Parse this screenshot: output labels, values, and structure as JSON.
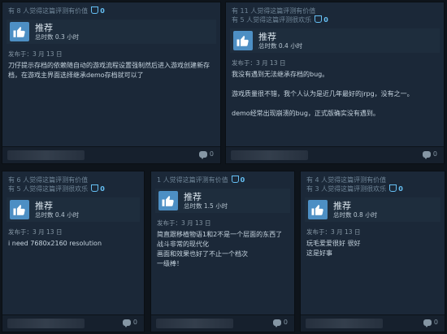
{
  "reviews": [
    {
      "helpful": [
        "有 8 人觉得这篇评测有价值"
      ],
      "award_count": "0",
      "verdict": "推荐",
      "hours": "总时数 0.3 小时",
      "posted": "发布于：3 月 13 日",
      "body": [
        "刀仔提示存档的依赖随自动的游戏流程设置强制然后进入游戏创建新存档，在游戏主界面选择继承demo存档就可以了"
      ],
      "comments": "0"
    },
    {
      "helpful": [
        "有 11 人觉得这篇评测有价值",
        "有 5 人觉得这篇评测很欢乐"
      ],
      "award_count": "0",
      "verdict": "推荐",
      "hours": "总时数 0.4 小时",
      "posted": "发布于：3 月 13 日",
      "body": [
        "我没有遇到无法继承存档的bug。",
        "游戏质量很不错，我个人认为是近几年最好的jrpg，没有之一。",
        "demo经常出现崩溃的bug，正式版确实没有遇到。"
      ],
      "comments": "0"
    },
    {
      "helpful": [
        "有 6 人觉得这篇评测有价值",
        "有 5 人觉得这篇评测很欢乐"
      ],
      "award_count": "0",
      "verdict": "推荐",
      "hours": "总时数 0.4 小时",
      "posted": "发布于：3 月 13 日",
      "body": [
        "i need 7680x2160 resolution"
      ],
      "comments": "0"
    },
    {
      "helpful": [
        "1 人觉得这篇评测有价值"
      ],
      "award_count": "0",
      "verdict": "推荐",
      "hours": "总时数 1.5 小时",
      "posted": "发布于：3 月 13 日",
      "body": [
        "简直跟移植物语1和2不是一个层面的东西了",
        "战斗非常的现代化",
        "画面和效果也好了不止一个档次",
        "一级棒！"
      ],
      "comments": "0"
    },
    {
      "helpful": [
        "有 4 人觉得这篇评测有价值",
        "有 3 人觉得这篇评测很欢乐"
      ],
      "award_count": "0",
      "verdict": "推荐",
      "hours": "总时数 0.8 小时",
      "posted": "发布于：3 月 13 日",
      "body": [
        "玩毛爱爱很好 很好",
        "这是好事"
      ],
      "comments": "0"
    }
  ]
}
